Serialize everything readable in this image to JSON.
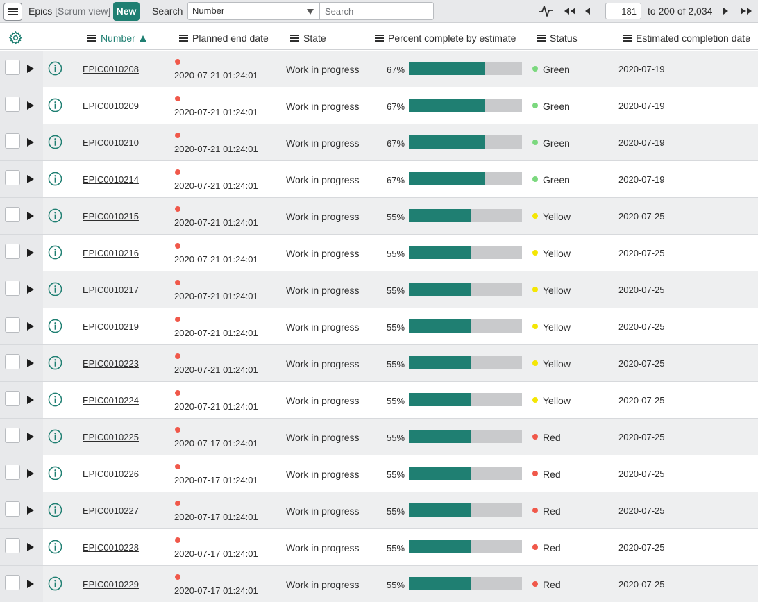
{
  "toolbar": {
    "title": "Epics",
    "view": "[Scrum view]",
    "new_label": "New",
    "search_label": "Search",
    "field_value": "Number",
    "search_placeholder": "Search",
    "page_value": "181",
    "range_text": "to 200 of 2,034"
  },
  "columns": {
    "number": "Number",
    "planned_end": "Planned end date",
    "state": "State",
    "percent": "Percent complete by estimate",
    "status": "Status",
    "estimated": "Estimated completion date"
  },
  "colors": {
    "accent": "#1f7f72",
    "date_dot": "#f0584a",
    "green": "#7bd87e",
    "yellow": "#f4e604",
    "red": "#f0584a"
  },
  "rows": [
    {
      "number": "EPIC0010208",
      "planned": "2020-07-21 01:24:01",
      "state": "Work in progress",
      "pct_text": "67%",
      "pct": 67,
      "status": "Green",
      "est": "2020-07-19"
    },
    {
      "number": "EPIC0010209",
      "planned": "2020-07-21 01:24:01",
      "state": "Work in progress",
      "pct_text": "67%",
      "pct": 67,
      "status": "Green",
      "est": "2020-07-19"
    },
    {
      "number": "EPIC0010210",
      "planned": "2020-07-21 01:24:01",
      "state": "Work in progress",
      "pct_text": "67%",
      "pct": 67,
      "status": "Green",
      "est": "2020-07-19"
    },
    {
      "number": "EPIC0010214",
      "planned": "2020-07-21 01:24:01",
      "state": "Work in progress",
      "pct_text": "67%",
      "pct": 67,
      "status": "Green",
      "est": "2020-07-19"
    },
    {
      "number": "EPIC0010215",
      "planned": "2020-07-21 01:24:01",
      "state": "Work in progress",
      "pct_text": "55%",
      "pct": 55,
      "status": "Yellow",
      "est": "2020-07-25"
    },
    {
      "number": "EPIC0010216",
      "planned": "2020-07-21 01:24:01",
      "state": "Work in progress",
      "pct_text": "55%",
      "pct": 55,
      "status": "Yellow",
      "est": "2020-07-25"
    },
    {
      "number": "EPIC0010217",
      "planned": "2020-07-21 01:24:01",
      "state": "Work in progress",
      "pct_text": "55%",
      "pct": 55,
      "status": "Yellow",
      "est": "2020-07-25"
    },
    {
      "number": "EPIC0010219",
      "planned": "2020-07-21 01:24:01",
      "state": "Work in progress",
      "pct_text": "55%",
      "pct": 55,
      "status": "Yellow",
      "est": "2020-07-25"
    },
    {
      "number": "EPIC0010223",
      "planned": "2020-07-21 01:24:01",
      "state": "Work in progress",
      "pct_text": "55%",
      "pct": 55,
      "status": "Yellow",
      "est": "2020-07-25"
    },
    {
      "number": "EPIC0010224",
      "planned": "2020-07-21 01:24:01",
      "state": "Work in progress",
      "pct_text": "55%",
      "pct": 55,
      "status": "Yellow",
      "est": "2020-07-25"
    },
    {
      "number": "EPIC0010225",
      "planned": "2020-07-17 01:24:01",
      "state": "Work in progress",
      "pct_text": "55%",
      "pct": 55,
      "status": "Red",
      "est": "2020-07-25"
    },
    {
      "number": "EPIC0010226",
      "planned": "2020-07-17 01:24:01",
      "state": "Work in progress",
      "pct_text": "55%",
      "pct": 55,
      "status": "Red",
      "est": "2020-07-25"
    },
    {
      "number": "EPIC0010227",
      "planned": "2020-07-17 01:24:01",
      "state": "Work in progress",
      "pct_text": "55%",
      "pct": 55,
      "status": "Red",
      "est": "2020-07-25"
    },
    {
      "number": "EPIC0010228",
      "planned": "2020-07-17 01:24:01",
      "state": "Work in progress",
      "pct_text": "55%",
      "pct": 55,
      "status": "Red",
      "est": "2020-07-25"
    },
    {
      "number": "EPIC0010229",
      "planned": "2020-07-17 01:24:01",
      "state": "Work in progress",
      "pct_text": "55%",
      "pct": 55,
      "status": "Red",
      "est": "2020-07-25"
    }
  ]
}
